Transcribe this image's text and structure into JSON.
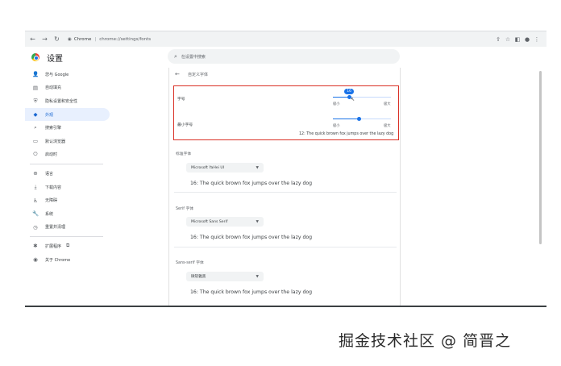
{
  "browser": {
    "site_name": "Chrome",
    "url": "chrome://settings/fonts",
    "back_icon": "arrow-left-icon",
    "forward_icon": "arrow-right-icon",
    "reload_icon": "reload-icon"
  },
  "header": {
    "title": "设置",
    "search_placeholder": "在设置中搜索"
  },
  "sidebar": {
    "items": [
      {
        "label": "您与 Google",
        "icon": "person-icon"
      },
      {
        "label": "自动填充",
        "icon": "clipboard-icon"
      },
      {
        "label": "隐私设置和安全性",
        "icon": "shield-icon"
      },
      {
        "label": "外观",
        "icon": "palette-icon",
        "active": true
      },
      {
        "label": "搜索引擎",
        "icon": "search-icon"
      },
      {
        "label": "默认浏览器",
        "icon": "browser-icon"
      },
      {
        "label": "启动时",
        "icon": "power-icon"
      },
      {
        "label": "语言",
        "icon": "globe-icon"
      },
      {
        "label": "下载内容",
        "icon": "download-icon"
      },
      {
        "label": "无障碍",
        "icon": "accessibility-icon"
      },
      {
        "label": "系统",
        "icon": "wrench-icon"
      },
      {
        "label": "重置并清理",
        "icon": "history-icon"
      },
      {
        "label": "扩展程序",
        "icon": "puzzle-icon"
      },
      {
        "label": "关于 Chrome",
        "icon": "chrome-icon"
      }
    ]
  },
  "content": {
    "back_label": "自定义字体",
    "font_size": {
      "label": "字号",
      "value": "16",
      "fraction": 0.28,
      "min_label": "极小",
      "max_label": "极大"
    },
    "min_font_size": {
      "label": "最小字号",
      "fraction": 0.45,
      "min_label": "极小",
      "max_label": "极大",
      "sample": "12: The quick brown fox jumps over the lazy dog"
    },
    "standard": {
      "label": "标准字体",
      "font": "Microsoft YaHei UI",
      "sample": "16: The quick brown fox jumps over the lazy dog"
    },
    "serif": {
      "label": "Serif 字体",
      "font": "Microsoft Sans Serif",
      "sample": "16: The quick brown fox jumps over the lazy dog"
    },
    "sans_serif": {
      "label": "Sans-serif 字体",
      "font": "微软雅黑",
      "sample": "16: The quick brown fox jumps over the lazy dog"
    }
  },
  "watermark": "掘金技术社区 @ 简晋之",
  "colors": {
    "accent": "#1a73e8",
    "highlight_border": "#d93025",
    "active_nav_bg": "#e8f0fe"
  }
}
